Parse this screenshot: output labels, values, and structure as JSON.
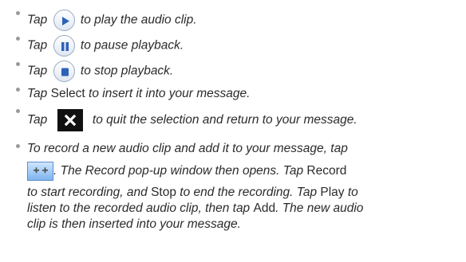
{
  "items": [
    {
      "pre": "Tap",
      "icon": "play-icon",
      "post": "to play the audio clip."
    },
    {
      "pre": "Tap",
      "icon": "pause-icon",
      "post": "to pause playback."
    },
    {
      "pre": "Tap",
      "icon": "stop-icon",
      "post": "to stop playback."
    },
    {
      "pre": "Tap",
      "keyword": "Select",
      "post": "to insert it into your message."
    },
    {
      "pre": "Tap",
      "icon": "close-icon",
      "post": "to quit the selection and return to your message."
    }
  ],
  "record": {
    "line1": "To record a new audio clip and add it to your message, tap",
    "icon": "record-icon",
    "line2_post": ". The Record pop-up window then opens. Tap",
    "kw_record": "Record",
    "line3_pre": "to start recording, and",
    "kw_stop": "Stop",
    "line3_mid": "to end the recording. Tap",
    "kw_play": "Play",
    "line3_post": "to",
    "line4_pre": "listen to the recorded audio clip, then tap",
    "kw_add": "Add",
    "line4_post": ". The new audio",
    "line5": "clip is then inserted into your message."
  },
  "colors": {
    "text": "#2b2b2b",
    "bullet": "#9a9a9a",
    "icon_blue": "#2c63b8",
    "icon_border": "#9aa9c0"
  }
}
